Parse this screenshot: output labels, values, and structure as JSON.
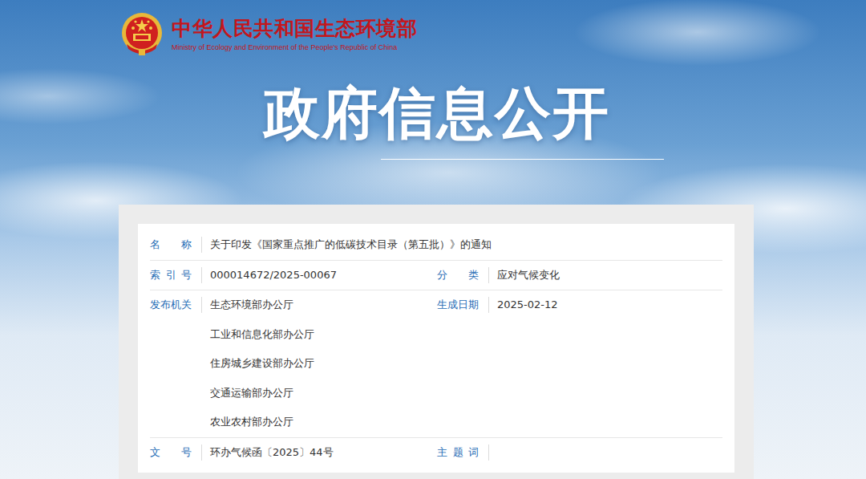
{
  "header": {
    "title": "中华人民共和国生态环境部",
    "subtitle": "Ministry of Ecology and Environment of the People's Republic of China"
  },
  "banner": {
    "title": "政府信息公开"
  },
  "info_table": {
    "rows": [
      {
        "fields": [
          {
            "label": "名称",
            "values": [
              "关于印发《国家重点推广的低碳技术目录（第五批）》的通知"
            ]
          }
        ]
      },
      {
        "fields": [
          {
            "label": "索引号",
            "values": [
              "000014672/2025-00067"
            ]
          },
          {
            "label": "分类",
            "values": [
              "应对气候变化"
            ]
          }
        ]
      },
      {
        "fields": [
          {
            "label": "发布机关",
            "values": [
              "生态环境部办公厅",
              "工业和信息化部办公厅",
              "住房城乡建设部办公厅",
              "交通运输部办公厅",
              "农业农村部办公厅"
            ]
          },
          {
            "label": "生成日期",
            "values": [
              "2025-02-12"
            ]
          }
        ]
      },
      {
        "fields": [
          {
            "label": "文号",
            "values": [
              "环办气候函〔2025〕44号"
            ]
          },
          {
            "label": "主题词",
            "values": []
          }
        ]
      }
    ]
  }
}
